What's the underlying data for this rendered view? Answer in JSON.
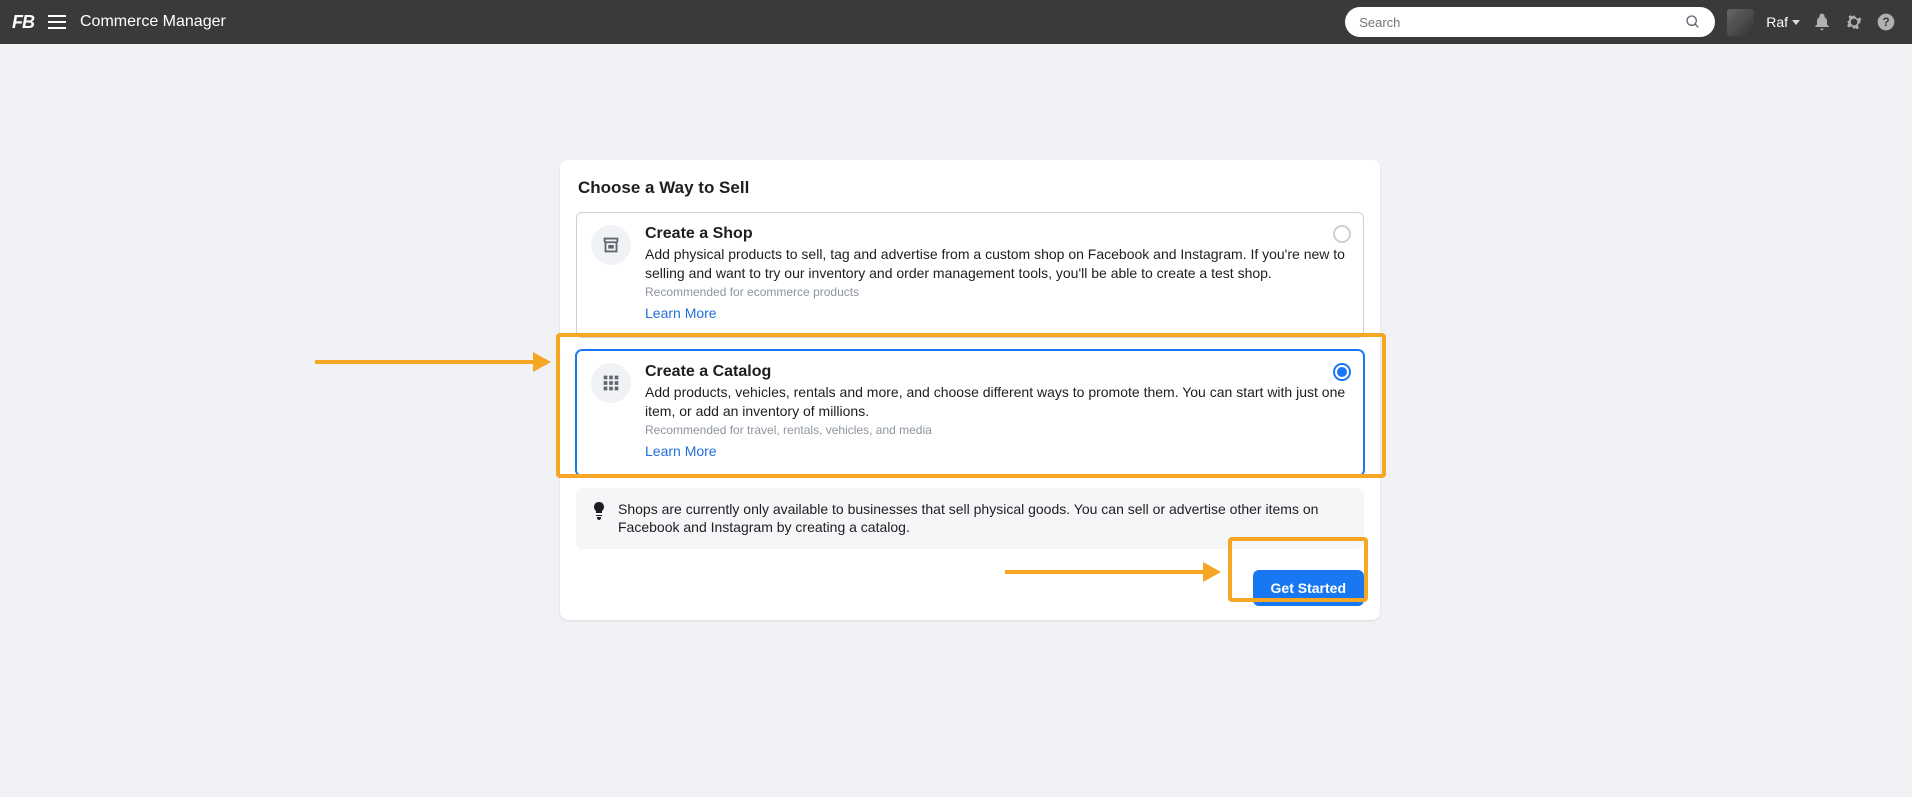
{
  "header": {
    "logo": "FB",
    "app_title": "Commerce Manager",
    "search_placeholder": "Search",
    "user_name": "Raf"
  },
  "panel": {
    "title": "Choose a Way to Sell",
    "options": [
      {
        "title": "Create a Shop",
        "description": "Add physical products to sell, tag and advertise from a custom shop on Facebook and Instagram. If you're new to selling and want to try our inventory and order management tools, you'll be able to create a test shop.",
        "recommended": "Recommended for ecommerce products",
        "learn_more": "Learn More",
        "selected": false
      },
      {
        "title": "Create a Catalog",
        "description": "Add products, vehicles, rentals and more, and choose different ways to promote them. You can start with just one item, or add an inventory of millions.",
        "recommended": "Recommended for travel, rentals, vehicles, and media",
        "learn_more": "Learn More",
        "selected": true
      }
    ],
    "info": "Shops are currently only available to businesses that sell physical goods. You can sell or advertise other items on Facebook and Instagram by creating a catalog.",
    "cta": "Get Started"
  }
}
